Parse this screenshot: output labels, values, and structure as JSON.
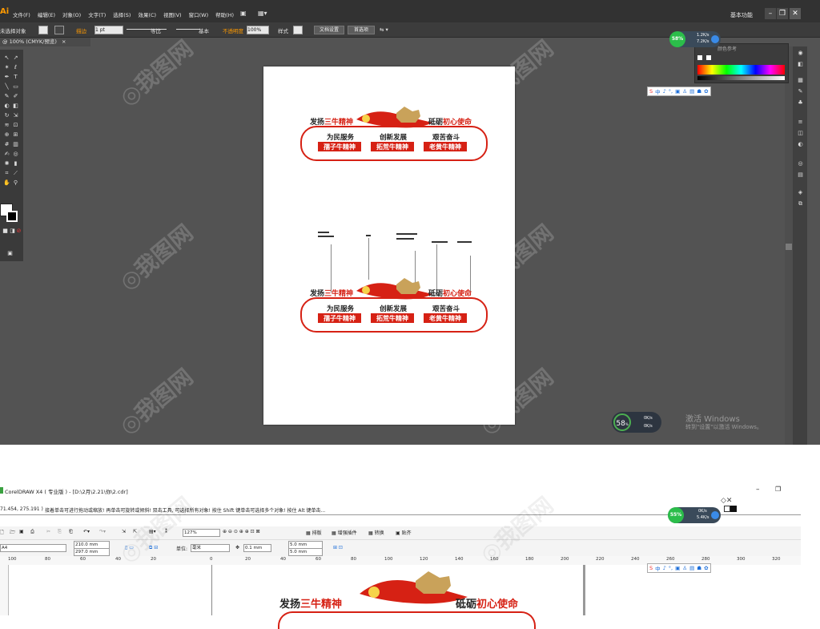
{
  "illustrator": {
    "logo": "Ai",
    "menu": [
      "文件(F)",
      "编辑(E)",
      "对象(O)",
      "文字(T)",
      "选择(S)",
      "效果(C)",
      "视图(V)",
      "窗口(W)",
      "帮助(H)"
    ],
    "workspace": "基本功能",
    "control": {
      "no_selection": "未选择对象",
      "stroke_label": "描边",
      "stroke_value": "1 pt",
      "profile": "等比",
      "brush": "基本",
      "opacity_label": "不透明度",
      "opacity_value": "100%",
      "style_label": "样式",
      "doc_setup": "文档设置",
      "preferences": "首选项"
    },
    "doc_tab": "@ 100% (CMYK/预览)",
    "color_panel_title": "颜色参考",
    "speed": {
      "percent": "58%",
      "up": "1.2K/s",
      "down": "7.2K/s"
    },
    "speed2": {
      "percent": "58",
      "up": "0K/s",
      "down": "0K/s"
    },
    "activate": {
      "line1": "激活 Windows",
      "line2": "转到\"设置\"以激活 Windows。"
    },
    "ime_items": [
      "中",
      "♪",
      "°,",
      "▣",
      "♙",
      "▤",
      "☗",
      "✿"
    ]
  },
  "design": {
    "left_slogan": "发扬",
    "left_red": "三牛精神",
    "right_slogan": "砥砺",
    "right_red": "初心使命",
    "phrases": [
      "为民服务",
      "创新发展",
      "艰苦奋斗"
    ],
    "spirits": [
      "孺子牛精神",
      "拓荒牛精神",
      "老黄牛精神"
    ]
  },
  "coreldraw": {
    "title": "CorelDRAW X4 ( 专业版 ) - [D:\\2月\\2.21\\你\\2.cdr]",
    "coords": "71.454, 275.191 )",
    "hint": "接着单击可进行拖动或缩放! 再单击可旋转或倾斜! 双击工具, 可选择所有对象! 按住 Shift 键单击可选择多个对象! 按住 Alt 键单击...",
    "zoom": "127%",
    "toolbar_labels": [
      "排版",
      "增强插件",
      "转换",
      "贴齐"
    ],
    "page_size": "A4",
    "width": "210.0 mm",
    "height": "297.0 mm",
    "unit_label": "单位:",
    "unit": "毫米",
    "nudge": "0.1 mm",
    "dup_x": "5.0 mm",
    "dup_y": "5.0 mm",
    "ruler": [
      "100",
      "80",
      "60",
      "40",
      "20",
      "0",
      "20",
      "40",
      "60",
      "80",
      "100",
      "120",
      "140",
      "160",
      "180",
      "200",
      "220",
      "240",
      "260",
      "280",
      "300",
      "320"
    ],
    "speed": {
      "percent": "55%",
      "up": "0K/s",
      "down": "5.4K/s"
    },
    "left_slogan": "发扬",
    "left_red": "三牛精神",
    "right_slogan": "砥砺",
    "right_red": "初心使命"
  },
  "colors": {
    "red": "#d62114",
    "gold": "#c9a25a",
    "ai_bg": "#535353"
  }
}
